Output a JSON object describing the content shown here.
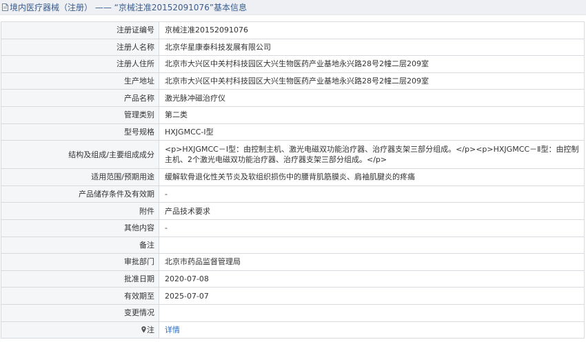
{
  "header": {
    "title": "境内医疗器械（注册） —— “京械注准20152091076”基本信息",
    "icon": "document-icon"
  },
  "rows": [
    {
      "key": "reg_no",
      "label": "注册证编号",
      "value": "京械注准20152091076"
    },
    {
      "key": "registrant",
      "label": "注册人名称",
      "value": "北京华星康泰科技发展有限公司"
    },
    {
      "key": "registrant_address",
      "label": "注册人住所",
      "value": "北京市大兴区中关村科技园区大兴生物医药产业基地永兴路28号2幢二层209室"
    },
    {
      "key": "production_address",
      "label": "生产地址",
      "value": "北京市大兴区中关村科技园区大兴生物医药产业基地永兴路28号2幢二层209室"
    },
    {
      "key": "product_name",
      "label": "产品名称",
      "value": "激光脉冲磁治疗仪"
    },
    {
      "key": "management_category",
      "label": "管理类别",
      "value": "第二类"
    },
    {
      "key": "model_spec",
      "label": "型号规格",
      "value": "HXJGMCC-Ⅰ型"
    },
    {
      "key": "structure",
      "label": "结构及组成/主要组成成分",
      "value": "<p>HXJGMCC－Ⅰ型：由控制主机、激光电磁双功能治疗器、治疗器支架三部分组成。</p><p>HXJGMCC－Ⅱ型：由控制主机、2个激光电磁双功能治疗器、治疗器支架三部分组成。</p>"
    },
    {
      "key": "scope",
      "label": "适用范围/预期用途",
      "value": "缓解软骨退化性关节炎及软组织损伤中的腰背肌筋膜炎、肩袖肌腱炎的疼痛"
    },
    {
      "key": "storage",
      "label": "产品储存条件及有效期",
      "value": "-"
    },
    {
      "key": "attachment",
      "label": "附件",
      "value": "产品技术要求"
    },
    {
      "key": "other",
      "label": "其他内容",
      "value": "-"
    },
    {
      "key": "remarks",
      "label": "备注",
      "value": ""
    },
    {
      "key": "approval_dept",
      "label": "审批部门",
      "value": "北京市药品监督管理局"
    },
    {
      "key": "approval_date",
      "label": "批准日期",
      "value": "2020-07-08"
    },
    {
      "key": "valid_until",
      "label": "有效期至",
      "value": "2025-07-07"
    },
    {
      "key": "changes",
      "label": "变更情况",
      "value": ""
    }
  ],
  "note_row": {
    "label": "注",
    "icon": "map-pin-icon",
    "link_text": "详情"
  },
  "colors": {
    "header_bg": "#eef0f3",
    "header_text": "#3a5d8f",
    "label_bg": "#f5f6f8",
    "border": "#d7dbe0",
    "link": "#2b6cc4"
  }
}
